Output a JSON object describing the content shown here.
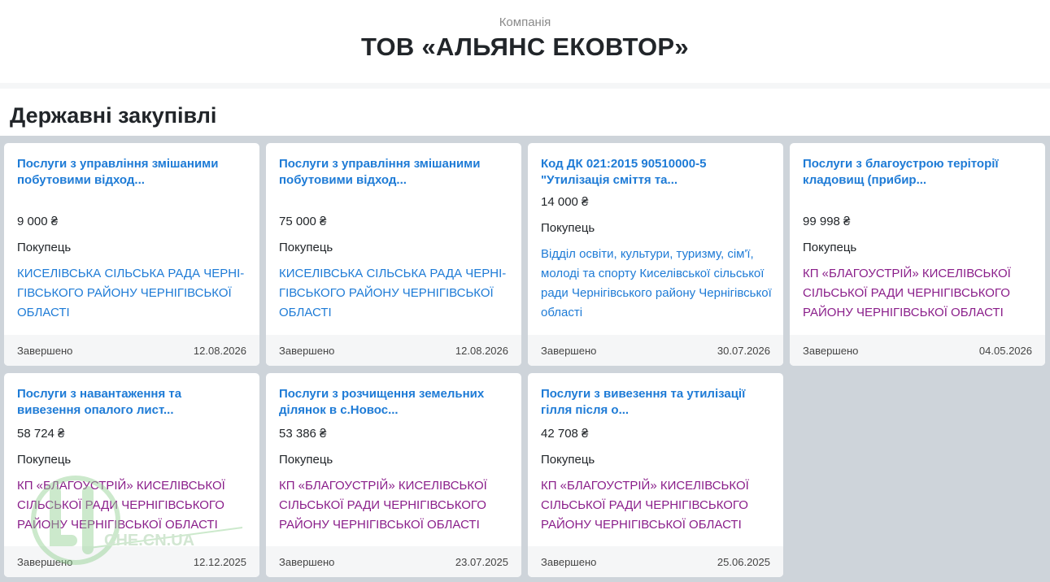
{
  "header": {
    "subtitle": "Компанія",
    "title": "ТОВ «АЛЬЯНС ЕКОВТОР»"
  },
  "section": {
    "title": "Державні закупівлі"
  },
  "watermark": {
    "text": "CHE.CN.UA"
  },
  "colors": {
    "link": "#1e7bd6",
    "visited": "#8a1e8a",
    "grid_bg": "#ced4da"
  },
  "cards": [
    {
      "title": "Послуги з управління змішаними побутовими відход...",
      "price": "9 000 ₴",
      "buyer_label": "Покупець",
      "buyer": "КИСЕЛІВСЬКА СІЛЬСЬКА РАДА ЧЕРНІ-ГІВСЬКОГО РАЙОНУ ЧЕРНІГІВСЬКОЇ ОБЛАСТІ",
      "status": "Завершено",
      "date": "12.08.2026"
    },
    {
      "title": "Послуги з управління змішаними побутовими відход...",
      "price": "75 000 ₴",
      "buyer_label": "Покупець",
      "buyer": "КИСЕЛІВСЬКА СІЛЬСЬКА РАДА ЧЕРНІ-ГІВСЬКОГО РАЙОНУ ЧЕРНІГІВСЬКОЇ ОБЛАСТІ",
      "status": "Завершено",
      "date": "12.08.2026"
    },
    {
      "title": "Код ДК 021:2015 90510000-5 \"Утилізація сміття та...",
      "price": "14 000 ₴",
      "buyer_label": "Покупець",
      "buyer": "Відділ освіти, культури, туризму, сім'ї, молоді та спорту Киселівської сільської ради Чернігівського району Чернігівської області",
      "status": "Завершено",
      "date": "30.07.2026"
    },
    {
      "title": "Послуги з благоустрою теріторії кладовищ (прибир...",
      "price": "99 998 ₴",
      "buyer_label": "Покупець",
      "buyer": "КП «БЛАГОУСТРІЙ» КИСЕЛІВСЬКОЇ СІЛЬСЬКОЇ РАДИ ЧЕРНІГІВСЬКОГО РАЙОНУ ЧЕРНІГІВСЬКОЇ ОБЛАСТІ",
      "status": "Завершено",
      "date": "04.05.2026"
    },
    {
      "title": "Послуги з навантаження та вивезення опалого лист...",
      "price": "58 724 ₴",
      "buyer_label": "Покупець",
      "buyer": "КП «БЛАГОУСТРІЙ» КИСЕЛІВСЬКОЇ СІЛЬСЬКОЇ РАДИ ЧЕРНІГІВСЬКОГО РАЙОНУ ЧЕРНІГІВСЬКОЇ ОБЛАСТІ",
      "status": "Завершено",
      "date": "12.12.2025"
    },
    {
      "title": "Послуги з розчищення земельних ділянок в с.Новос...",
      "price": "53 386 ₴",
      "buyer_label": "Покупець",
      "buyer": "КП «БЛАГОУСТРІЙ» КИСЕЛІВСЬКОЇ СІЛЬСЬКОЇ РАДИ ЧЕРНІГІВСЬКОГО РАЙОНУ ЧЕРНІГІВСЬКОЇ ОБЛАСТІ",
      "status": "Завершено",
      "date": "23.07.2025"
    },
    {
      "title": "Послуги з вивезення та утилізації гілля після о...",
      "price": "42 708 ₴",
      "buyer_label": "Покупець",
      "buyer": "КП «БЛАГОУСТРІЙ» КИСЕЛІВСЬКОЇ СІЛЬСЬКОЇ РАДИ ЧЕРНІГІВСЬКОГО РАЙОНУ ЧЕРНІГІВСЬКОЇ ОБЛАСТІ",
      "status": "Завершено",
      "date": "25.06.2025"
    }
  ]
}
